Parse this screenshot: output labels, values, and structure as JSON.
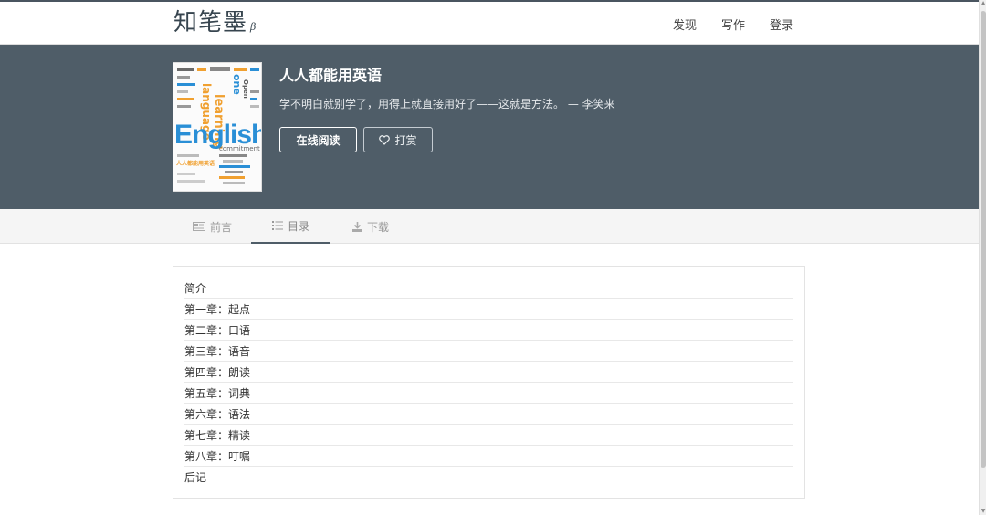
{
  "nav": {
    "logo": "知笔墨",
    "logo_beta": "β",
    "links": [
      "发现",
      "写作",
      "登录"
    ]
  },
  "book": {
    "title": "人人都能用英语",
    "quote": "学不明白就别学了，用得上就直接用好了——这就是方法。 — 李笑来",
    "read_label": "在线阅读",
    "tip_label": "打赏",
    "cover_title": "English",
    "cover_words": [
      "learning",
      "language",
      "one",
      "Open",
      "commitment"
    ],
    "cover_caption": "人人都能用英语"
  },
  "tabs": [
    {
      "label": "前言",
      "icon": "newspaper-icon",
      "active": false
    },
    {
      "label": "目录",
      "icon": "list-icon",
      "active": true
    },
    {
      "label": "下载",
      "icon": "download-icon",
      "active": false
    }
  ],
  "toc": [
    "简介",
    "第一章：起点",
    "第二章：口语",
    "第三章：语音",
    "第四章：朗读",
    "第五章：词典",
    "第六章：语法",
    "第七章：精读",
    "第八章：叮嘱",
    "后记"
  ],
  "colors": {
    "hero_bg": "#4f5d68",
    "logo": "#37454f",
    "cover_blue": "#2a8fd6",
    "cover_orange": "#f0a030"
  }
}
